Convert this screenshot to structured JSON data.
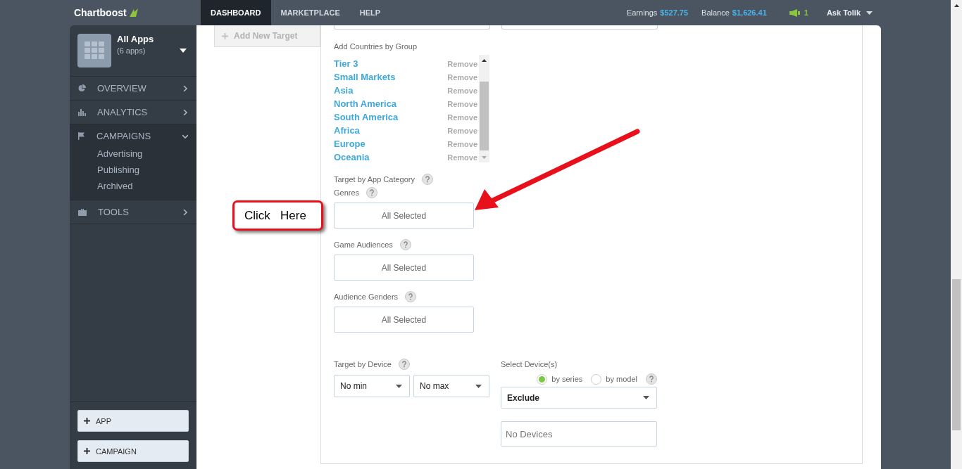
{
  "topbar": {
    "logo": "Chartboost",
    "tabs": [
      {
        "label": "DASHBOARD",
        "selected": true
      },
      {
        "label": "MARKETPLACE",
        "selected": false
      },
      {
        "label": "HELP",
        "selected": false
      }
    ],
    "earnings_label": "Earnings",
    "earnings": "$527.75",
    "balance_label": "Balance",
    "balance": "$1,626.41",
    "notifications": "1",
    "user": "Ask Tolik"
  },
  "sidebar": {
    "app_title": "All Apps",
    "app_count": "(6 apps)",
    "items": [
      {
        "label": "OVERVIEW",
        "kind": "pie",
        "expanded": false
      },
      {
        "label": "ANALYTICS",
        "kind": "bars",
        "expanded": false
      },
      {
        "label": "CAMPAIGNS",
        "kind": "flag",
        "expanded": true,
        "children": [
          "Advertising",
          "Publishing",
          "Archived"
        ]
      },
      {
        "label": "TOOLS",
        "kind": "toolbox",
        "expanded": false
      }
    ],
    "buttons": [
      "APP",
      "CAMPAIGN"
    ]
  },
  "targets": {
    "add_label": "Add New Target"
  },
  "form": {
    "group_label": "Add Countries by Group",
    "groups": [
      {
        "name": "Tier 3",
        "action": "Remove"
      },
      {
        "name": "Small Markets",
        "action": "Remove"
      },
      {
        "name": "Asia",
        "action": "Remove"
      },
      {
        "name": "North America",
        "action": "Remove"
      },
      {
        "name": "South America",
        "action": "Remove"
      },
      {
        "name": "Africa",
        "action": "Remove"
      },
      {
        "name": "Europe",
        "action": "Remove"
      },
      {
        "name": "Oceania",
        "action": "Remove"
      }
    ],
    "category_label": "Target by App Category",
    "category_fields": [
      {
        "label": "Genres",
        "value": "All Selected"
      },
      {
        "label": "Game Audiences",
        "value": "All Selected"
      },
      {
        "label": "Audience Genders",
        "value": "All Selected"
      }
    ],
    "device_label": "Target by Device",
    "min": "No min",
    "max": "No max",
    "select_label": "Select Device(s)",
    "modes": [
      {
        "label": "by series",
        "selected": true
      },
      {
        "label": "by model",
        "selected": false
      }
    ],
    "mode_select": "Exclude",
    "devices_placeholder": "No Devices"
  },
  "annotation": {
    "text": "Click   Here"
  }
}
